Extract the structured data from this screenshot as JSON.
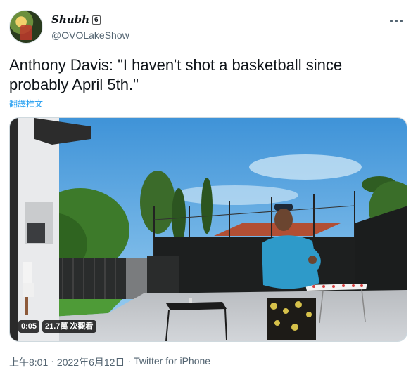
{
  "author": {
    "display_name": "Shubh",
    "badge": "6",
    "handle": "@OVOLakeShow"
  },
  "tweet": {
    "text": "Anthony Davis: \"I haven't shot a basketball since probably April 5th.\"",
    "translate_label": "翻譯推文"
  },
  "video": {
    "elapsed": "0:05",
    "views": "21.7萬 次觀看"
  },
  "meta": {
    "time": "上午8:01",
    "separator": "·",
    "date": "2022年6月12日",
    "source": "Twitter for iPhone"
  },
  "icons": {
    "more": "more-options-icon"
  },
  "colors": {
    "link": "#1d9bf0",
    "secondary_text": "#536471",
    "primary_text": "#0f1419"
  }
}
